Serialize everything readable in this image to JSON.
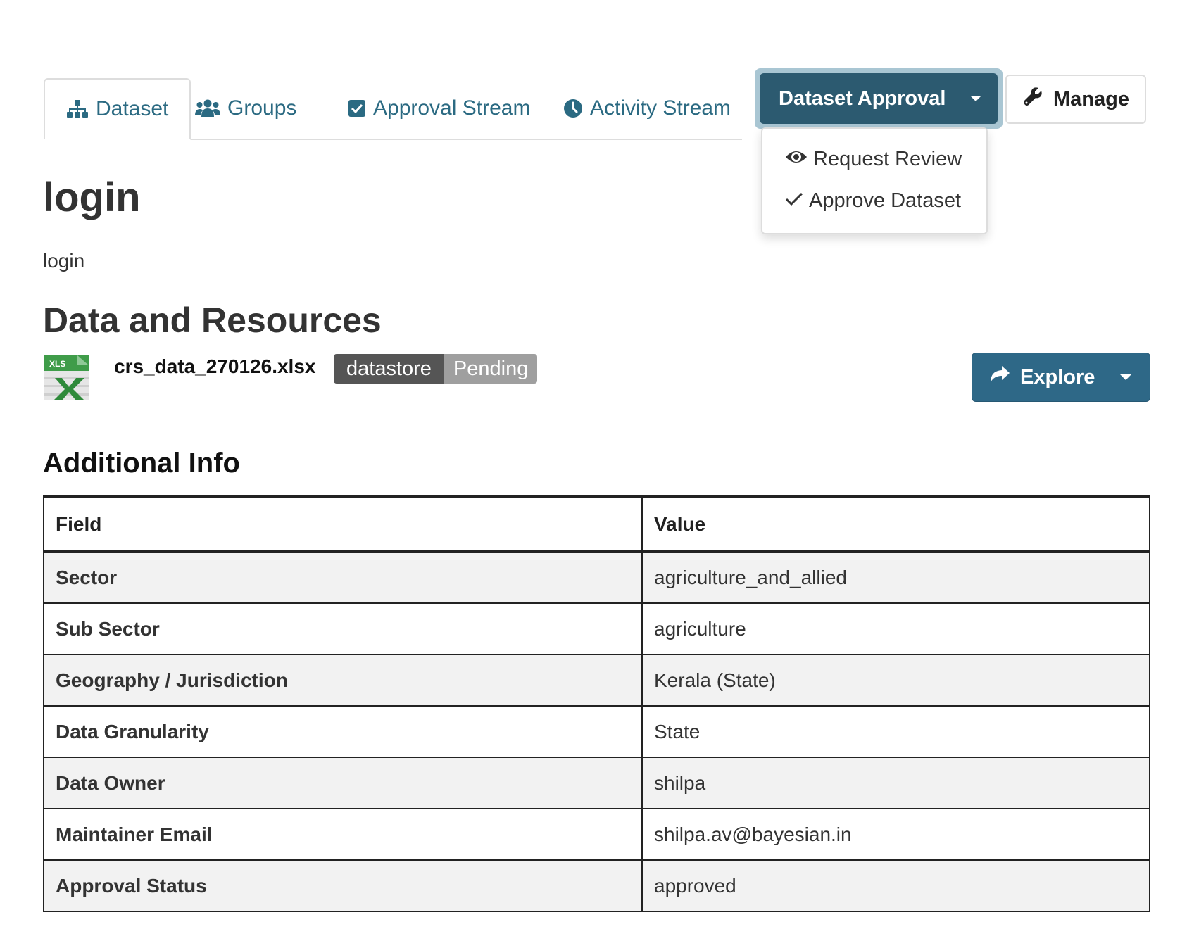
{
  "tabs": [
    {
      "label": "Dataset",
      "icon": "sitemap-icon",
      "active": true
    },
    {
      "label": "Groups",
      "icon": "users-icon",
      "active": false
    },
    {
      "label": "Approval Stream",
      "icon": "check-square-icon",
      "active": false
    },
    {
      "label": "Activity Stream",
      "icon": "clock-icon",
      "active": false
    }
  ],
  "actions": {
    "approval_label": "Dataset Approval",
    "manage_label": "Manage"
  },
  "approval_menu": {
    "items": [
      {
        "label": "Request Review",
        "icon": "eye-icon"
      },
      {
        "label": "Approve Dataset",
        "icon": "checkmark-icon"
      }
    ]
  },
  "dataset": {
    "title": "login",
    "description": "login"
  },
  "resources": {
    "heading": "Data and Resources",
    "items": [
      {
        "file_name": "crs_data_270126.xlsx",
        "format_icon_label": "XLS",
        "badge_label": "datastore",
        "badge_status": "Pending",
        "explore_label": "Explore"
      }
    ]
  },
  "additional_info": {
    "heading": "Additional Info",
    "columns": [
      "Field",
      "Value"
    ],
    "rows": [
      {
        "field": "Sector",
        "value": "agriculture_and_allied"
      },
      {
        "field": "Sub Sector",
        "value": "agriculture"
      },
      {
        "field": "Geography / Jurisdiction",
        "value": "Kerala (State)"
      },
      {
        "field": "Data Granularity",
        "value": "State"
      },
      {
        "field": "Data Owner",
        "value": "shilpa"
      },
      {
        "field": "Maintainer Email",
        "value": "shilpa.av@bayesian.in"
      },
      {
        "field": "Approval Status",
        "value": "approved"
      }
    ]
  },
  "colors": {
    "link": "#2b6a82",
    "primary": "#2c5a70",
    "explore": "#2e6887"
  }
}
